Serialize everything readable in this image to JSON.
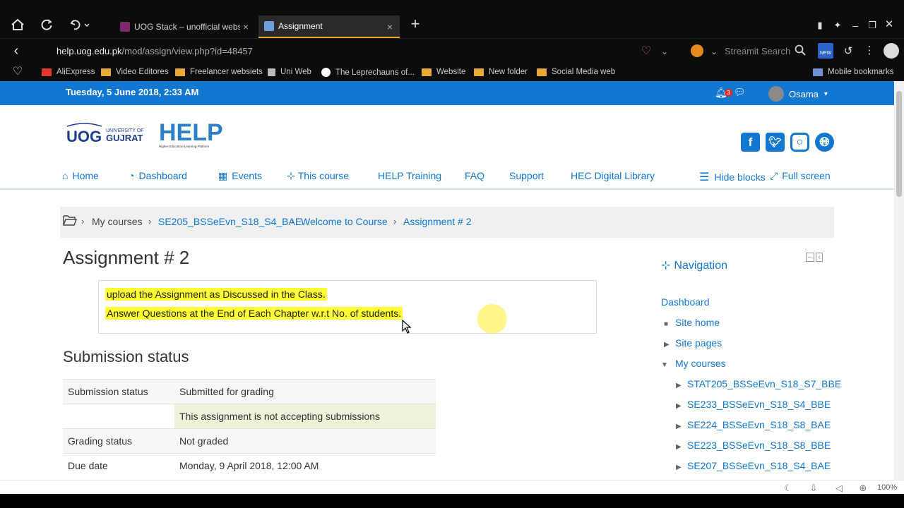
{
  "browser": {
    "tabs": [
      {
        "title": "UOG Stack – unofficial websit",
        "close": "×"
      },
      {
        "title": "Assignment",
        "close": "×"
      }
    ],
    "new_tab": "+",
    "url_host": "help.uog.edu.pk",
    "url_path": "/mod/assign/view.php?id=48457",
    "search_placeholder": "Streamit Search",
    "bookmarks": [
      "AliExpress",
      "Video Editores",
      "Freelancer websiets",
      "Uni Web",
      "The Leprechauns of...",
      "Website",
      "New folder",
      "Social Media web"
    ],
    "mobile_bookmarks": "Mobile bookmarks",
    "zoom": "100%",
    "new_badge": "NEW"
  },
  "topbar": {
    "date": "Tuesday, 5 June 2018, 2:33 AM",
    "notification_count": "3",
    "user_name": "Osama"
  },
  "logos": {
    "uog_text_1": "UNIVERSITY OF",
    "uog_text_2": "GUJRAT",
    "help_text": "HELP",
    "help_subtext": "Higher Education Learning Platform"
  },
  "nav": {
    "items": [
      "Home",
      "Dashboard",
      "Events",
      "This course",
      "HELP Training",
      "FAQ",
      "Support",
      "HEC Digital Library"
    ],
    "hide_blocks": "Hide blocks",
    "full_screen": "Full screen"
  },
  "breadcrumb": [
    "My courses",
    "SE205_BSSeEvn_S18_S4_BAE",
    "Welcome to Course",
    "Assignment # 2"
  ],
  "page_title": "Assignment # 2",
  "intro": {
    "line1": "upload the Assignment as Discussed in the Class.",
    "line2": "Answer Questions at the End of Each Chapter w.r.t No. of students."
  },
  "submission": {
    "heading": "Submission status",
    "rows": [
      {
        "label": "Submission status",
        "value": "Submitted for grading"
      },
      {
        "label": "",
        "value": "This assignment is not accepting submissions"
      },
      {
        "label": "Grading status",
        "value": "Not graded"
      },
      {
        "label": "Due date",
        "value": "Monday, 9 April 2018, 12:00 AM"
      }
    ]
  },
  "navigation_block": {
    "title": "Navigation",
    "dashboard": "Dashboard",
    "site_home": "Site home",
    "site_pages": "Site pages",
    "my_courses": "My courses",
    "courses": [
      "STAT205_BSSeEvn_S18_S7_BBE",
      "SE233_BSSeEvn_S18_S4_BBE",
      "SE224_BSSeEvn_S18_S8_BAE",
      "SE223_BSSeEvn_S18_S8_BBE",
      "SE207_BSSeEvn_S18_S4_BAE"
    ]
  },
  "colors": {
    "brand_blue": "#1177d1",
    "highlight_yellow": "#ffff33",
    "notice_bg": "#edf2d8"
  },
  "icons": [
    "home-icon",
    "refresh-icon",
    "undo-icon",
    "back-icon",
    "heart-icon",
    "search-icon",
    "bell-icon",
    "chat-icon",
    "facebook-icon",
    "twitter-icon",
    "instagram-icon",
    "globe-icon",
    "folder-icon",
    "sitemap-icon"
  ]
}
